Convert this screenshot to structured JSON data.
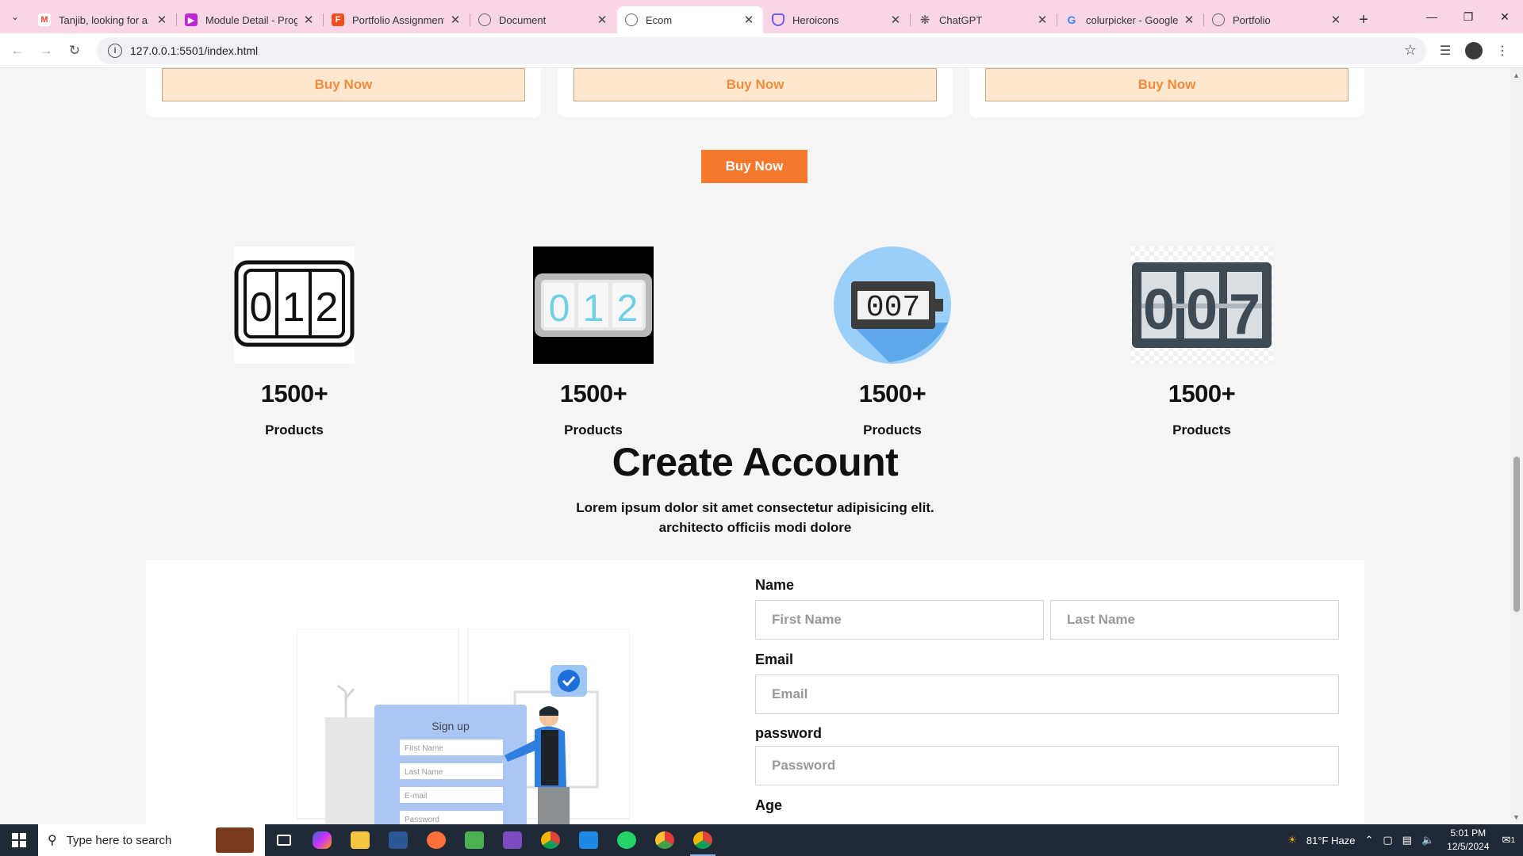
{
  "browser": {
    "tabs": [
      {
        "title": "Tanjib, looking for a n",
        "icon": "gmail-icon",
        "color": "#ea4335"
      },
      {
        "title": "Module Detail - Prog",
        "icon": "module-icon",
        "color": "#c026d3"
      },
      {
        "title": "Portfolio Assignment",
        "icon": "figma-icon",
        "color": "#f24e1e"
      },
      {
        "title": "Document",
        "icon": "globe-icon",
        "color": "#666666"
      },
      {
        "title": "Ecom",
        "icon": "globe-icon",
        "color": "#666666",
        "active": true
      },
      {
        "title": "Heroicons",
        "icon": "shield-icon",
        "color": "#6b5cf6"
      },
      {
        "title": "ChatGPT",
        "icon": "chatgpt-icon",
        "color": "#555555"
      },
      {
        "title": "colurpicker - Google",
        "icon": "google-icon",
        "color": "#4285f4"
      },
      {
        "title": "Portfolio",
        "icon": "globe-icon",
        "color": "#666666"
      }
    ],
    "url": "127.0.0.1:5501/index.html"
  },
  "page": {
    "card_buttons": [
      "Buy Now",
      "Buy Now",
      "Buy Now"
    ],
    "buy_now_main": "Buy Now",
    "stats": [
      {
        "number": "1500+",
        "label": "Products"
      },
      {
        "number": "1500+",
        "label": "Products"
      },
      {
        "number": "1500+",
        "label": "Products"
      },
      {
        "number": "1500+",
        "label": "Products"
      }
    ],
    "counter_digits": {
      "icon1": [
        "0",
        "1",
        "2"
      ],
      "icon2": [
        "0",
        "1",
        "2"
      ],
      "icon3": "007",
      "icon4": [
        "0",
        "0",
        "7"
      ]
    },
    "create_account": {
      "title": "Create Account",
      "subtitle_line1": "Lorem ipsum dolor sit amet consectetur adipisicing elit.",
      "subtitle_line2": "architecto officiis modi dolore"
    },
    "illustration": {
      "heading": "Sign up",
      "fields": [
        "First Name",
        "Last Name",
        "E-mail",
        "Password"
      ]
    },
    "form": {
      "name_label": "Name",
      "first_name_placeholder": "First Name",
      "last_name_placeholder": "Last Name",
      "email_label": "Email",
      "email_placeholder": "Email",
      "password_label": "password",
      "password_placeholder": "Password",
      "age_label": "Age"
    }
  },
  "taskbar": {
    "search_placeholder": "Type here to search",
    "weather": "81°F  Haze",
    "time": "5:01 PM",
    "date": "12/5/2024",
    "notification_count": "1"
  },
  "colors": {
    "tab_strip": "#f9d6e6",
    "accent_orange": "#f6782d",
    "buy_outline_bg": "#ffe8cf"
  }
}
